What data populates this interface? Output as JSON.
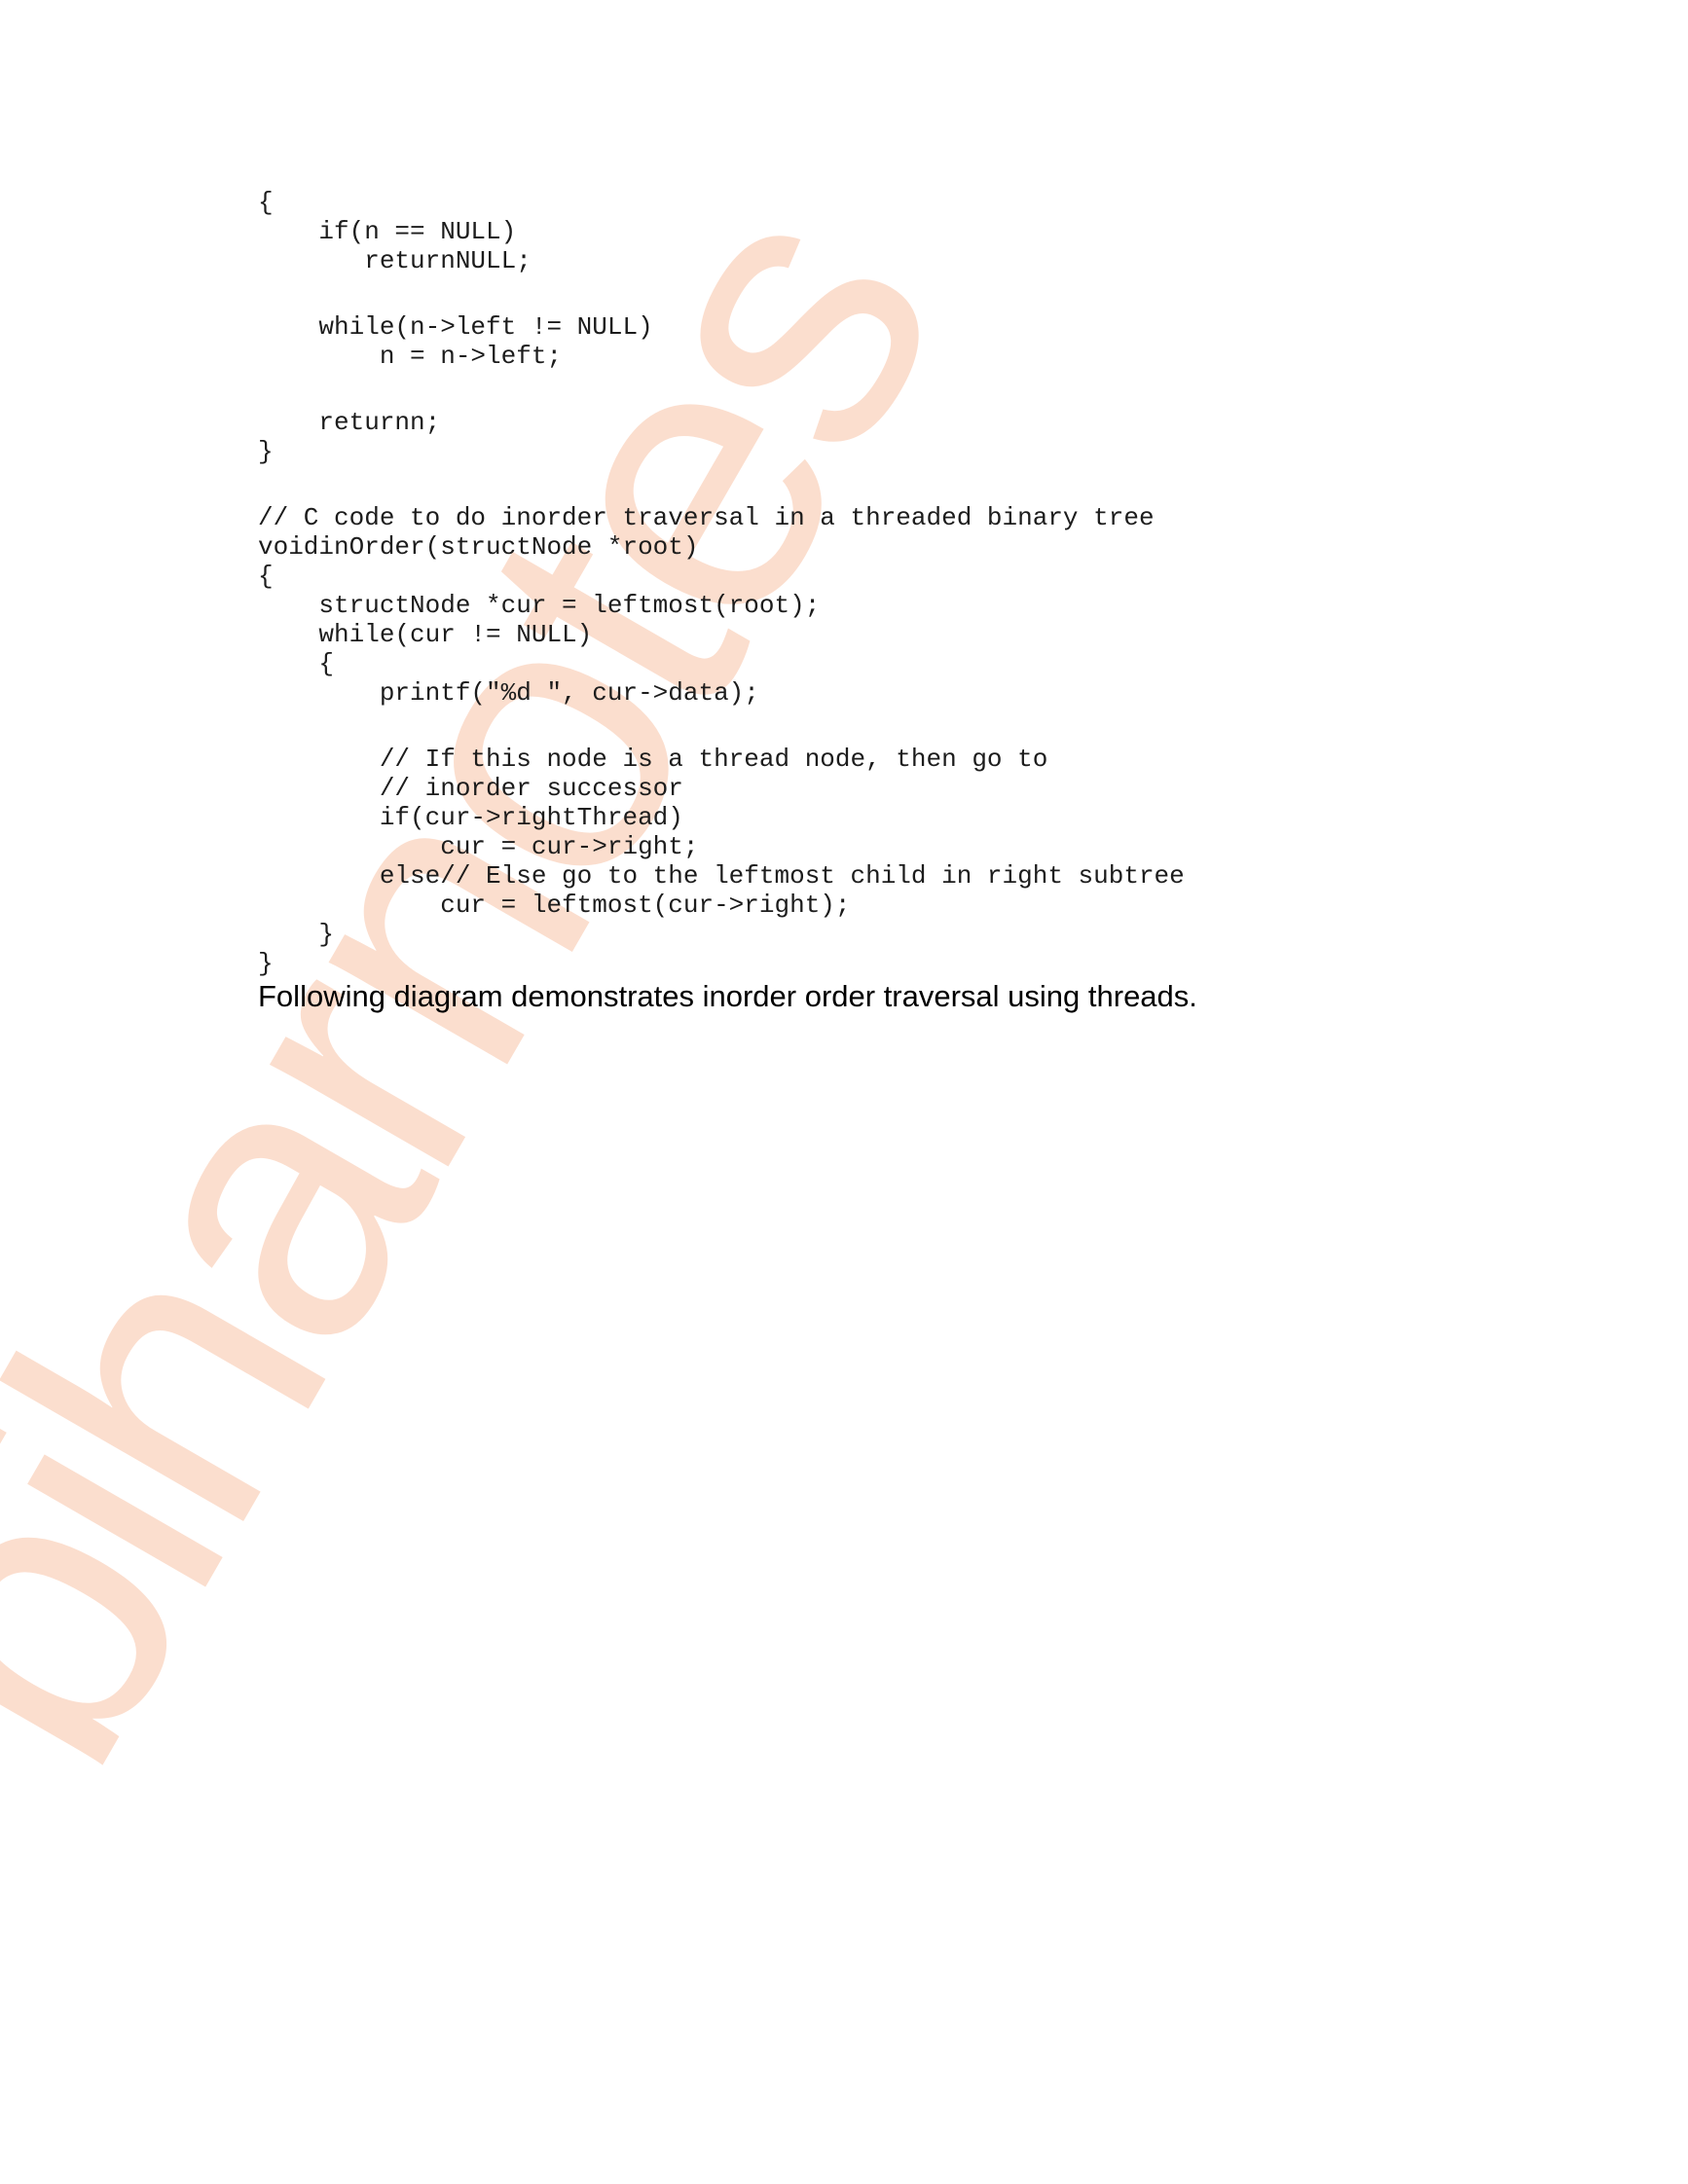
{
  "watermark": "biharnotes",
  "code_lines": [
    "{",
    "    if(n == NULL)",
    "       returnNULL;",
    "",
    "    while(n->left != NULL)",
    "        n = n->left;",
    "",
    "    returnn;",
    "}",
    "",
    "// C code to do inorder traversal in a threaded binary tree",
    "voidinOrder(structNode *root)",
    "{",
    "    structNode *cur = leftmost(root);",
    "    while(cur != NULL)",
    "    {",
    "        printf(\"%d \", cur->data);",
    "",
    "        // If this node is a thread node, then go to",
    "        // inorder successor",
    "        if(cur->rightThread)",
    "            cur = cur->right;",
    "        else// Else go to the leftmost child in right subtree",
    "            cur = leftmost(cur->right);",
    "    }",
    "}"
  ],
  "caption": "Following diagram demonstrates inorder order traversal using threads."
}
